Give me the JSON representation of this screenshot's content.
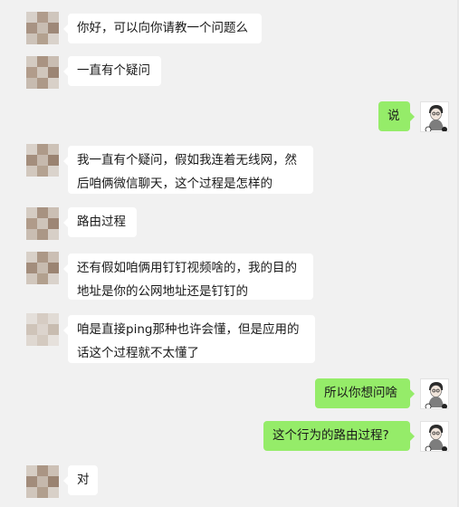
{
  "chat": {
    "messages": [
      {
        "from": "other",
        "text": "你好，可以向你请教一个问题么"
      },
      {
        "from": "other",
        "text": "一直有个疑问"
      },
      {
        "from": "me",
        "text": "说"
      },
      {
        "from": "other",
        "text": "我一直有个疑问，假如我连着无线网，然\n后咱俩微信聊天，这个过程是怎样的"
      },
      {
        "from": "other",
        "text": "路由过程"
      },
      {
        "from": "other",
        "text": "还有假如咱俩用钉钉视频啥的，我的目的\n地址是你的公网地址还是钉钉的"
      },
      {
        "from": "other",
        "text": "咱是直接ping那种也许会懂，但是应用的\n话这个过程就不太懂了"
      },
      {
        "from": "me",
        "text": "所以你想问啥"
      },
      {
        "from": "me",
        "text": "这个行为的路由过程?"
      },
      {
        "from": "other",
        "text": "对"
      }
    ]
  },
  "colors": {
    "background": "#f1f1f1",
    "incoming_bubble": "#ffffff",
    "outgoing_bubble": "#95ec69",
    "text": "#191919"
  },
  "icons": {
    "other_avatar": "pixelated-avatar-icon",
    "my_avatar": "cartoon-person-avatar-icon"
  }
}
